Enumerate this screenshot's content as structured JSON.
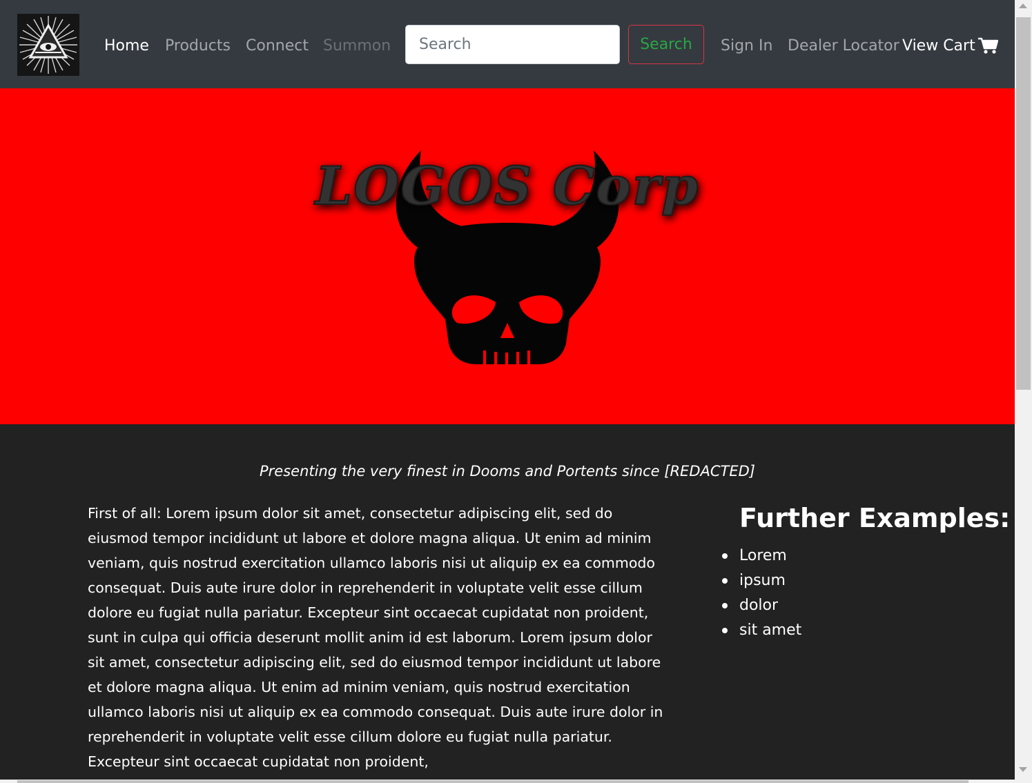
{
  "navbar": {
    "logo_icon": "illuminati-eye-icon",
    "links": [
      {
        "label": "Home",
        "state": "active"
      },
      {
        "label": "Products",
        "state": "normal"
      },
      {
        "label": "Connect",
        "state": "normal"
      },
      {
        "label": "Summon",
        "state": "disabled"
      }
    ],
    "search": {
      "placeholder": "Search",
      "button_label": "Search"
    },
    "right_links": [
      {
        "label": "Sign In"
      },
      {
        "label": "Dealer Locator"
      }
    ],
    "cart": {
      "label": "View Cart",
      "icon": "cart-icon"
    }
  },
  "hero": {
    "background": "#ff0000",
    "logo_text": "LOGOS Corp",
    "emblem_icon": "horned-skull-icon"
  },
  "main": {
    "tagline": "Presenting the very finest in Dooms and Portents since [REDACTED]",
    "body": "First of all: Lorem ipsum dolor sit amet, consectetur adipiscing elit, sed do eiusmod tempor incididunt ut labore et dolore magna aliqua. Ut enim ad minim veniam, quis nostrud exercitation ullamco laboris nisi ut aliquip ex ea commodo consequat. Duis aute irure dolor in reprehenderit in voluptate velit esse cillum dolore eu fugiat nulla pariatur. Excepteur sint occaecat cupidatat non proident, sunt in culpa qui officia deserunt mollit anim id est laborum. Lorem ipsum dolor sit amet, consectetur adipiscing elit, sed do eiusmod tempor incididunt ut labore et dolore magna aliqua. Ut enim ad minim veniam, quis nostrud exercitation ullamco laboris nisi ut aliquip ex ea commodo consequat. Duis aute irure dolor in reprehenderit in voluptate velit esse cillum dolore eu fugiat nulla pariatur. Excepteur sint occaecat cupidatat non proident,"
  },
  "aside": {
    "heading": "Further Examples:",
    "items": [
      "Lorem",
      "ipsum",
      "dolor",
      "sit amet"
    ]
  },
  "colors": {
    "navbar_bg": "#343a40",
    "page_bg": "#222222",
    "search_button_border": "#dc3545",
    "search_button_text": "#28a745"
  }
}
